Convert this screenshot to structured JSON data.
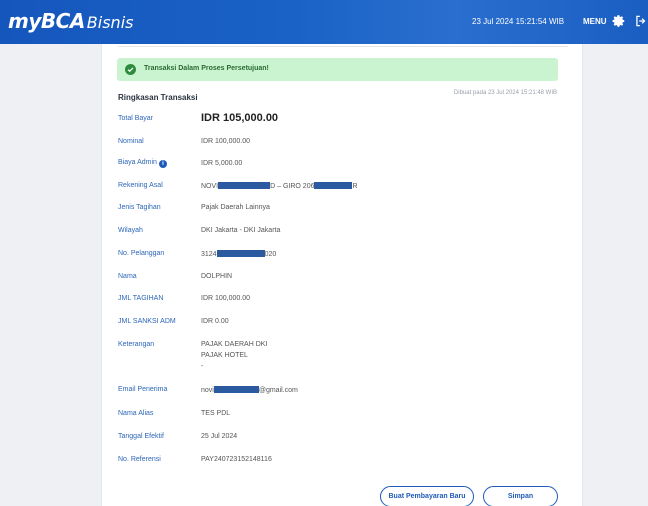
{
  "header": {
    "logo_my": "my",
    "logo_bca": "BCA",
    "logo_bisnis": "Bisnis",
    "datetime": "23 Jul 2024 15:21:54 WIB",
    "menu_label": "MENU",
    "settings_icon": "gear-icon",
    "logout_icon": "logout-icon"
  },
  "alert": {
    "text": "Transaksi Dalam Proses Persetujuan!",
    "icon": "check-circle-icon",
    "color": "#c9f4cf"
  },
  "summary": {
    "title": "Ringkasan Transaksi",
    "created_at": "Dibuat pada 23 Jul 2024 15:21:48 WIB"
  },
  "rows": {
    "total_bayar": {
      "label": "Total Bayar",
      "value": "IDR 105,000.00"
    },
    "nominal": {
      "label": "Nominal",
      "value": "IDR 100,000.00"
    },
    "biaya_admin": {
      "label": "Biaya Admin",
      "value": "IDR 5,000.00"
    },
    "rekening_asal": {
      "label": "Rekening Asal",
      "value_a": "NOVI",
      "value_b": "D – GIRO 206",
      "value_c": "R"
    },
    "jenis_tagihan": {
      "label": "Jenis Tagihan",
      "value": "Pajak Daerah Lainnya"
    },
    "wilayah": {
      "label": "Wilayah",
      "value": "DKI Jakarta - DKI Jakarta"
    },
    "no_pelanggan": {
      "label": "No. Pelanggan",
      "value_a": "3124",
      "value_b": "020"
    },
    "nama": {
      "label": "Nama",
      "value": "DOLPHIN"
    },
    "jml_tagihan": {
      "label": "JML TAGIHAN",
      "value": "IDR 100,000.00"
    },
    "jml_sanksi": {
      "label": "JML SANKSI ADM",
      "value": "IDR 0.00"
    },
    "keterangan": {
      "label": "Keterangan",
      "line1": "PAJAK DAERAH DKI",
      "line2": "PAJAK HOTEL",
      "line3": "-"
    },
    "email": {
      "label": "Email Penerima",
      "value_a": "novi",
      "value_b": "@gmail.com"
    },
    "nama_alias": {
      "label": "Nama Alias",
      "value": "TES PDL"
    },
    "tanggal_efektif": {
      "label": "Tanggal Efektif",
      "value": "25 Jul 2024"
    },
    "no_referensi": {
      "label": "No. Referensi",
      "value": "PAY240723152148116"
    }
  },
  "buttons": {
    "new_payment": "Buat Pembayaran Baru",
    "save": "Simpan"
  },
  "colors": {
    "header": "#1a5cbf",
    "label": "#2d66b8",
    "accent": "#1e5bb8"
  }
}
